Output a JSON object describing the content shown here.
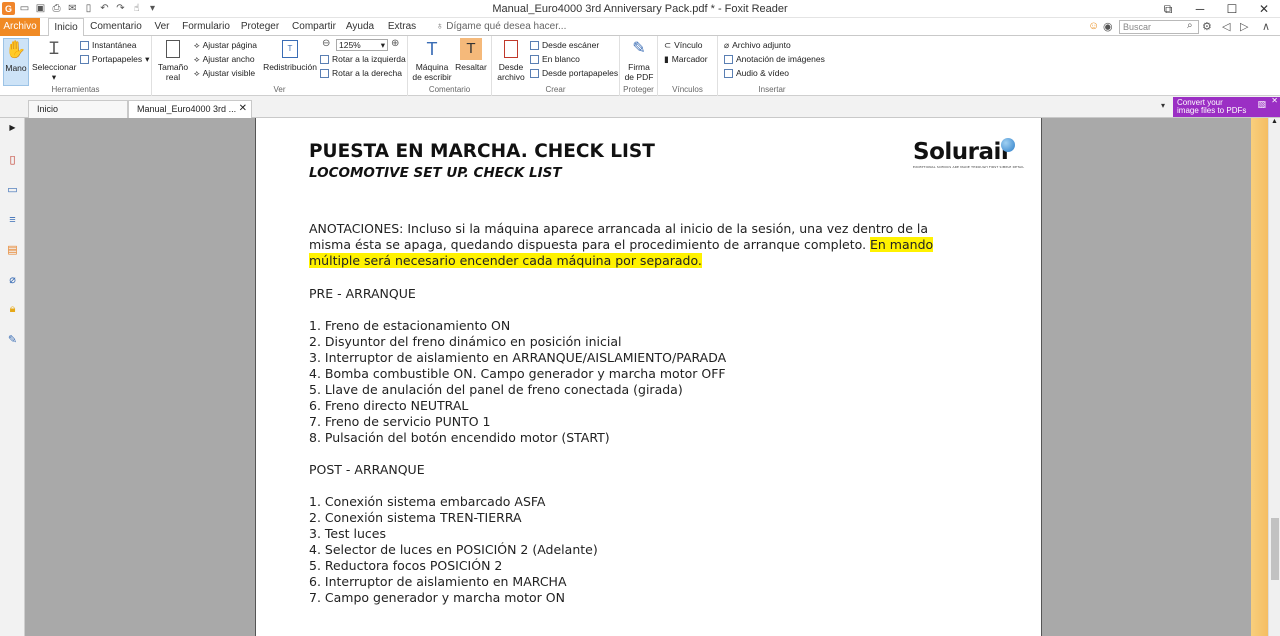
{
  "window": {
    "title": "Manual_Euro4000 3rd Anniversary Pack.pdf * - Foxit Reader"
  },
  "menu": {
    "tabs": [
      "Archivo",
      "Inicio",
      "Comentario",
      "Ver",
      "Formulario",
      "Proteger",
      "Compartir",
      "Ayuda",
      "Extras"
    ],
    "tell_me": "Dígame qué desea hacer...",
    "search_placeholder": "Buscar"
  },
  "ribbon": {
    "herramientas": {
      "label": "Herramientas",
      "mano": "Mano",
      "seleccionar": "Seleccionar",
      "instantanea": "Instantánea",
      "portapapeles": "Portapapeles"
    },
    "ver": {
      "label": "Ver",
      "tamano": "Tamaño",
      "real": "real",
      "ajustar_pagina": "Ajustar página",
      "ajustar_ancho": "Ajustar ancho",
      "ajustar_visible": "Ajustar visible",
      "redistribucion": "Redistribución",
      "zoom": "125%",
      "rotar_izq": "Rotar a la izquierda",
      "rotar_der": "Rotar a la derecha"
    },
    "comentario": {
      "label": "Comentario",
      "maquina1": "Máquina",
      "maquina2": "de escribir",
      "resaltar": "Resaltar"
    },
    "crear": {
      "label": "Crear",
      "desde1": "Desde",
      "desde2": "archivo",
      "escaner": "Desde escáner",
      "blanco": "En blanco",
      "portapapeles": "Desde portapapeles"
    },
    "proteger": {
      "label": "Proteger",
      "firma1": "Firma",
      "firma2": "de PDF"
    },
    "vinculos": {
      "label": "Vínculos",
      "vinculo": "Vínculo",
      "marcador": "Marcador"
    },
    "insertar": {
      "label": "Insertar",
      "adjunto": "Archivo adjunto",
      "imagen": "Anotación de imágenes",
      "audio": "Audio & vídeo"
    }
  },
  "doc_tabs": {
    "home": "Inicio",
    "current": "Manual_Euro4000 3rd ..."
  },
  "banner": {
    "line1": "Convert your",
    "line2": "image files to PDFs"
  },
  "document": {
    "brand": "Solurail",
    "brand_tagline": "EXCEPTIONAL SCENICS ARE MADE THROUGH FIRST SIMPLE DETAIL",
    "title": "PUESTA EN MARCHA. CHECK LIST",
    "subtitle": "LOCOMOTIVE SET UP. CHECK LIST",
    "notes_plain": "ANOTACIONES: Incluso si la máquina aparece arrancada al inicio de la sesión, una vez dentro de la misma ésta se apaga, quedando dispuesta para el procedimiento de arranque completo. ",
    "notes_highlight": "En mando múltiple será necesario encender cada máquina por separado.",
    "pre_heading": "PRE - ARRANQUE",
    "pre_items": [
      "1. Freno de estacionamiento ON",
      "2. Disyuntor del freno dinámico en posición inicial",
      "3. Interruptor de aislamiento en ARRANQUE/AISLAMIENTO/PARADA",
      "4. Bomba combustible ON. Campo generador y marcha motor OFF",
      "5. Llave de anulación del panel de freno conectada (girada)",
      "6. Freno directo NEUTRAL",
      "7. Freno de servicio PUNTO 1",
      "8. Pulsación del botón encendido motor (START)"
    ],
    "post_heading": "POST - ARRANQUE",
    "post_items": [
      "1. Conexión sistema embarcado ASFA",
      "2. Conexión sistema TREN-TIERRA",
      "3. Test luces",
      "4. Selector de luces en POSICIÓN 2 (Adelante)",
      "5. Reductora focos POSICIÓN 2",
      "6. Interruptor de aislamiento en MARCHA",
      "7. Campo generador y marcha motor ON"
    ]
  }
}
